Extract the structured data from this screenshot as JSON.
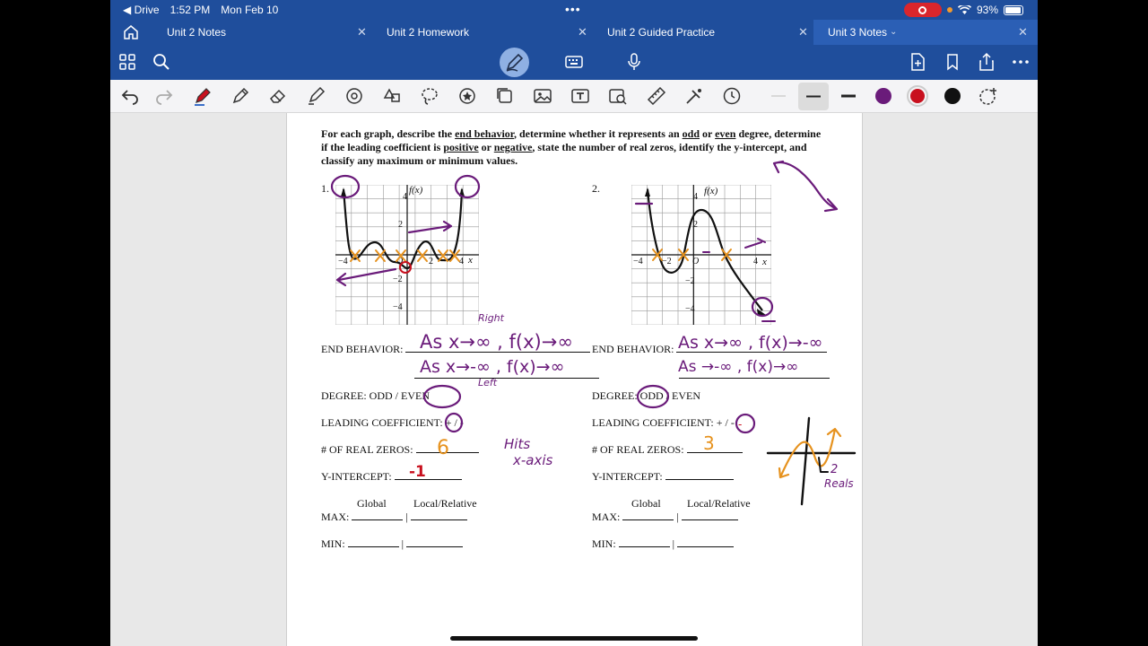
{
  "status": {
    "back_app": "◀ Drive",
    "time": "1:52 PM",
    "date": "Mon Feb 10",
    "battery": "93%"
  },
  "tabs": [
    {
      "label": "Unit 2 Notes"
    },
    {
      "label": "Unit 2 Homework"
    },
    {
      "label": "Unit 2 Guided Practice"
    },
    {
      "label": "Unit 3 Notes"
    }
  ],
  "icons": {
    "home": "house-icon",
    "grid": "grid-icon",
    "search": "search-icon",
    "pen_mode": "pen-icon",
    "keyboard": "keyboard-icon",
    "mic": "microphone-icon",
    "add_page": "add-page-icon",
    "bookmark": "bookmark-icon",
    "share": "share-icon",
    "more": "more-icon"
  },
  "colors": {
    "accent": "#1f4e9c",
    "purple": "#6a1b7a",
    "orange": "#e6921e",
    "red": "#c8101e"
  },
  "worksheet": {
    "instructions_1": "For each graph, describe the ",
    "instructions_end_behavior": "end behavior",
    "instructions_2": ", determine whether it represents an ",
    "instructions_odd": "odd",
    "instructions_or": " or ",
    "instructions_even": "even",
    "instructions_3": " degree, determine if the leading coefficient is ",
    "instructions_positive": "positive",
    "instructions_or2": " or ",
    "instructions_negative": "negative",
    "instructions_4": ", state the number of real zeros, identify the y-intercept, and classify any maximum or minimum values.",
    "q1": "1.",
    "q2": "2.",
    "end_behavior": "END BEHAVIOR:",
    "degree": "DEGREE: ODD / EVEN",
    "leading": "LEADING COEFFICIENT: + / -",
    "zeros": "# OF REAL ZEROS:",
    "yint": "Y-INTERCEPT:",
    "global": "Global",
    "local": "Local/Relative",
    "max": "MAX:",
    "min": "MIN:",
    "axis_fx": "f(x)",
    "axis_x": "x",
    "tick_4": "4",
    "tick_2": "2",
    "tick_neg2": "−2",
    "tick_neg4": "−4",
    "tick_o": "O"
  },
  "annotations": {
    "q1_end_1": "As x→∞ , f(x)→∞",
    "q1_end_2": "As x→-∞ , f(x)→∞",
    "right": "Right",
    "left": "Left",
    "q1_zeros": "6",
    "q1_hits": "Hits",
    "q1_xaxis": "x-axis",
    "q1_yint": "-1",
    "q2_end_1": "As x→∞ , f(x)→-∞",
    "q2_end_2": "As →-∞ , f(x)→∞",
    "q2_zeros": "3",
    "q2_reals": "2",
    "q2_reals_word": "Reals",
    "q2_minus": "-",
    "q1_plus": "+",
    "q2_plus_sign": "-"
  }
}
